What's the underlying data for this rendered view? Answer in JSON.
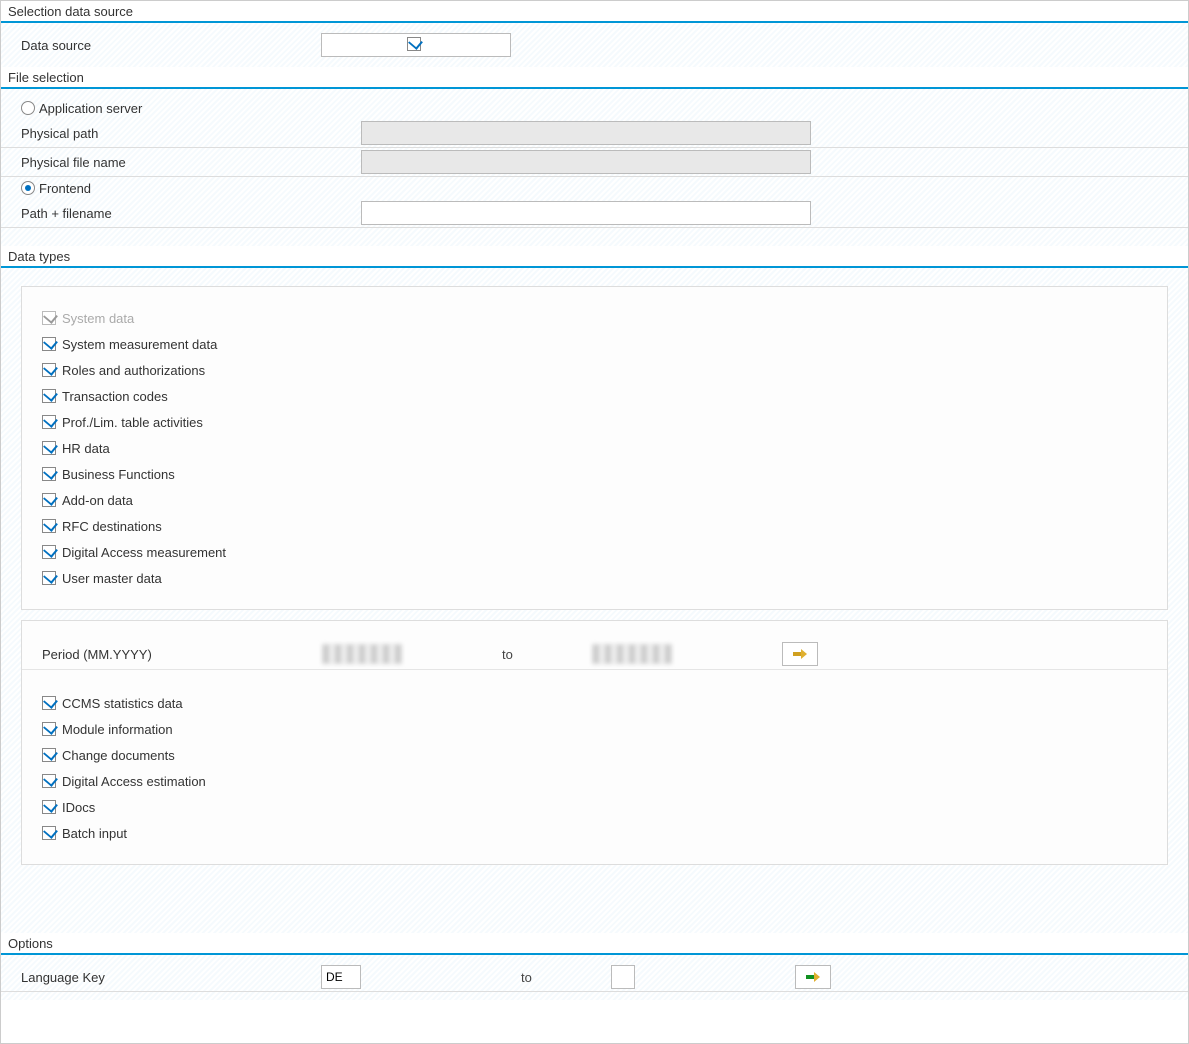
{
  "selection_data_source": {
    "title": "Selection data source",
    "data_source_label": "Data source",
    "data_source_checked": true
  },
  "file_selection": {
    "title": "File selection",
    "application_server": {
      "label": "Application server",
      "selected": false
    },
    "physical_path": {
      "label": "Physical path",
      "value": ""
    },
    "physical_file_name": {
      "label": "Physical file name",
      "value": ""
    },
    "frontend": {
      "label": "Frontend",
      "selected": true
    },
    "path_filename": {
      "label": "Path + filename",
      "value": ""
    }
  },
  "data_types": {
    "title": "Data types",
    "checkboxes_top": [
      {
        "label": "System data",
        "checked": true,
        "disabled": true
      },
      {
        "label": "System measurement data",
        "checked": true,
        "disabled": false
      },
      {
        "label": "Roles and authorizations",
        "checked": true,
        "disabled": false
      },
      {
        "label": "Transaction codes",
        "checked": true,
        "disabled": false
      },
      {
        "label": "Prof./Lim. table activities",
        "checked": true,
        "disabled": false
      },
      {
        "label": "HR data",
        "checked": true,
        "disabled": false
      },
      {
        "label": "Business Functions",
        "checked": true,
        "disabled": false
      },
      {
        "label": "Add-on data",
        "checked": true,
        "disabled": false
      },
      {
        "label": "RFC destinations",
        "checked": true,
        "disabled": false
      },
      {
        "label": "Digital Access measurement",
        "checked": true,
        "disabled": false
      },
      {
        "label": "User master data",
        "checked": true,
        "disabled": false
      }
    ],
    "period": {
      "label": "Period (MM.YYYY)",
      "from": "",
      "to_label": "to",
      "to": ""
    },
    "checkboxes_bottom": [
      {
        "label": "CCMS statistics data",
        "checked": true
      },
      {
        "label": "Module information",
        "checked": true
      },
      {
        "label": "Change documents",
        "checked": true
      },
      {
        "label": "Digital Access estimation",
        "checked": true
      },
      {
        "label": "IDocs",
        "checked": true
      },
      {
        "label": "Batch input",
        "checked": true
      }
    ]
  },
  "options": {
    "title": "Options",
    "language_key": {
      "label": "Language Key",
      "from": "DE",
      "to_label": "to",
      "to": ""
    }
  }
}
